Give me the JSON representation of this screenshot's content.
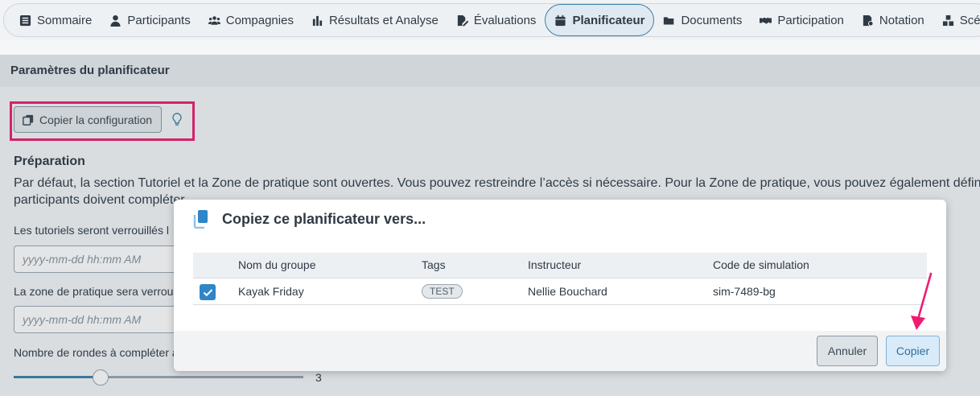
{
  "nav": {
    "tabs": [
      {
        "label": "Sommaire",
        "icon": "list-icon"
      },
      {
        "label": "Participants",
        "icon": "user-icon"
      },
      {
        "label": "Compagnies",
        "icon": "users-icon"
      },
      {
        "label": "Résultats et Analyse",
        "icon": "bar-chart-icon"
      },
      {
        "label": "Évaluations",
        "icon": "edit-icon"
      },
      {
        "label": "Planificateur",
        "icon": "calendar-icon",
        "active": true
      },
      {
        "label": "Documents",
        "icon": "folder-icon"
      },
      {
        "label": "Participation",
        "icon": "handshake-icon"
      },
      {
        "label": "Notation",
        "icon": "grade-icon"
      },
      {
        "label": "Scénario",
        "icon": "boxes-icon"
      }
    ]
  },
  "page": {
    "panel_title": "Paramètres du planificateur",
    "copy_config_label": "Copier la configuration",
    "prep_title": "Préparation",
    "prep_text": "Par défaut, la section Tutoriel et la Zone de pratique sont ouvertes. Vous pouvez restreindre l’accès si nécessaire. Pour la Zone de pratique, vous pouvez également défin",
    "prep_text2": "participants doivent compléter.",
    "tutorials_label": "Les tutoriels seront verrouillés l",
    "tutorials_placeholder": "yyyy-mm-dd hh:mm AM",
    "practice_label": "La zone de pratique sera verroui",
    "practice_placeholder": "yyyy-mm-dd hh:mm AM",
    "rounds_label": "Nombre de rondes à compléter a",
    "rounds_value": "3",
    "rounds_fraction": 0.3
  },
  "modal": {
    "title": "Copiez ce planificateur vers...",
    "columns": [
      "",
      "Nom du groupe",
      "Tags",
      "Instructeur",
      "Code de simulation"
    ],
    "rows": [
      {
        "checked": true,
        "group": "Kayak Friday",
        "tag": "TEST",
        "instructor": "Nellie Bouchard",
        "code": "sim-7489-bg"
      }
    ],
    "cancel_label": "Annuler",
    "copy_label": "Copier"
  },
  "colors": {
    "accent": "#3d7fa8",
    "highlight": "#ee1c6e",
    "checkbox": "#2f86c8"
  }
}
